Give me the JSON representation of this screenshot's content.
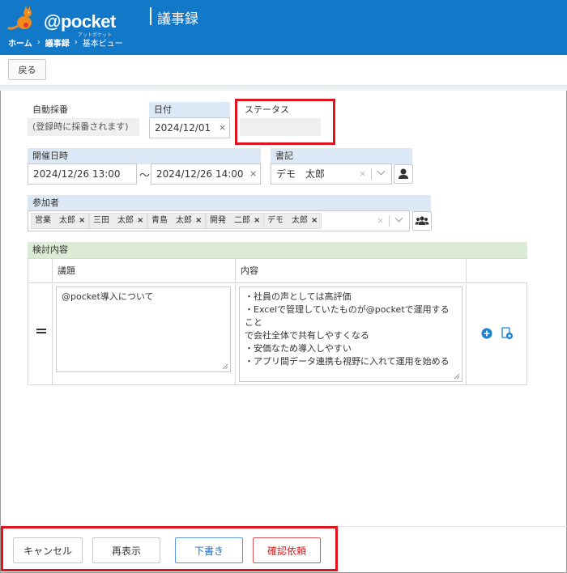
{
  "header": {
    "logo_text": "@pocket",
    "logo_sub": "アットポケット",
    "title": "議事録",
    "breadcrumb": [
      "ホーム",
      "議事録",
      "基本ビュー"
    ]
  },
  "toolbar": {
    "back_label": "戻る"
  },
  "form": {
    "auto_number": {
      "label": "自動採番",
      "value": "(登録時に採番されます)"
    },
    "date": {
      "label": "日付",
      "value": "2024/12/01"
    },
    "status": {
      "label": "ステータス",
      "value": ""
    },
    "datetime": {
      "label": "開催日時",
      "start": "2024/12/26 13:00",
      "separator": "〜",
      "end": "2024/12/26 14:00"
    },
    "clerk": {
      "label": "書記",
      "value": "デモ　太郎"
    },
    "participants": {
      "label": "参加者",
      "items": [
        "営業　太郎",
        "三田　太郎",
        "青島　太郎",
        "開発　二郎",
        "デモ　太郎"
      ]
    },
    "discussion": {
      "label": "検討内容",
      "columns": [
        "議題",
        "内容"
      ],
      "rows": [
        {
          "topic": "@pocket導入について",
          "content": [
            "・社員の声としては高評価",
            "・Excelで管理していたものが@pocketで運用すること",
            "で会社全体で共有しやすくなる",
            "・安価なため導入しやすい",
            "・アプリ間データ連携も視野に入れて運用を始める"
          ]
        }
      ]
    }
  },
  "actions": {
    "cancel": "キャンセル",
    "redisplay": "再表示",
    "draft": "下書き",
    "request_confirm": "確認依頼"
  },
  "colors": {
    "header_bg": "#1278c8",
    "label_blue": "#dce8f5",
    "label_green": "#dcebd5",
    "highlight_red": "#e0141c",
    "action_blue": "#1c6fc6",
    "action_red": "#d02020"
  }
}
